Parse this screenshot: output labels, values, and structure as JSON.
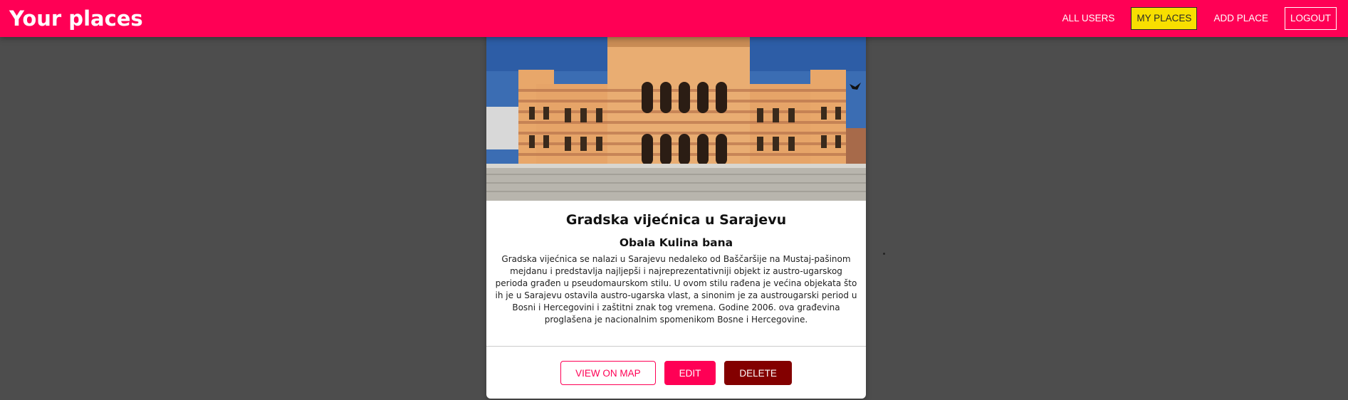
{
  "header": {
    "title": "Your places",
    "nav": {
      "all_users": "ALL USERS",
      "my_places": "MY PLACES",
      "add_place": "ADD PLACE",
      "logout": "LOGOUT"
    }
  },
  "place": {
    "title": "Gradska vijećnica u Sarajevu",
    "address": "Obala Kulina bana",
    "description": "Gradska vijećnica se nalazi u Sarajevu nedaleko od Baščaršije na Mustaj-pašinom mejdanu i predstavlja najljepši i najreprezentativniji objekt iz austro-ugarskog perioda građen u pseudomaurskom stilu. U ovom stilu rađena je većina objekata što ih je u Sarajevu ostavila austro-ugarska vlast, a sinonim je za austrougarski period u Bosni i Hercegovini i zaštitni znak tog vremena. Godine 2006. ova građevina proglašena je nacionalnim spomenikom Bosne i Hercegovine.",
    "image_icon": "building-photo",
    "actions": {
      "view_on_map": "VIEW ON MAP",
      "edit": "EDIT",
      "delete": "DELETE"
    }
  },
  "colors": {
    "brand": "#ff0055",
    "active_nav": "#f8df00",
    "danger": "#830000",
    "backdrop": "#4d4d4d"
  }
}
